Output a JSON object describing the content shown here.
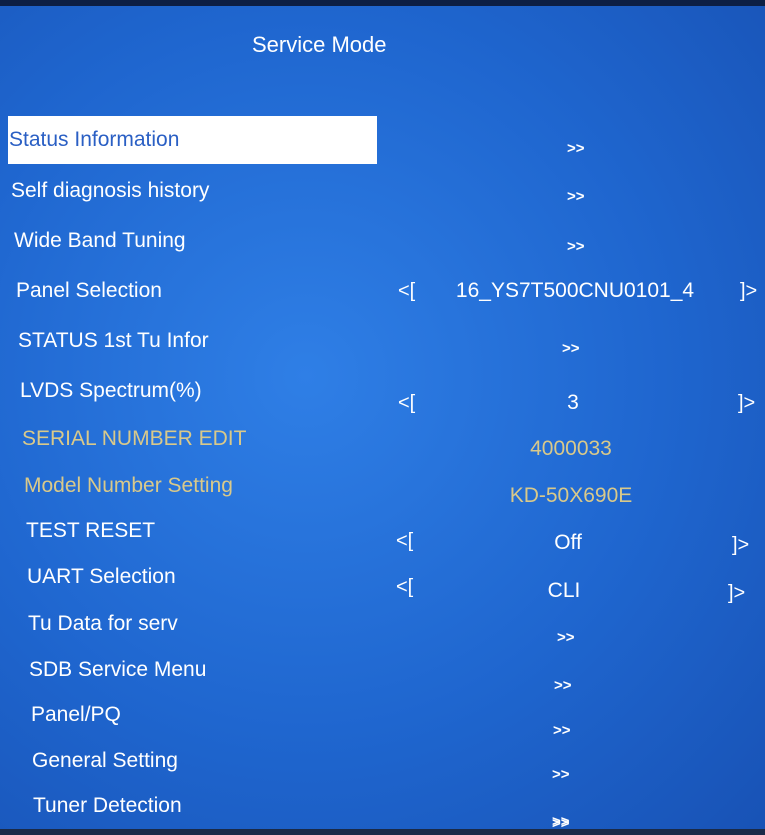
{
  "title": "Service Mode",
  "menu": [
    {
      "label": "Status Information",
      "kind": "submenu",
      "value": ">>"
    },
    {
      "label": "Self diagnosis history",
      "kind": "submenu",
      "value": ">>"
    },
    {
      "label": "Wide Band Tuning",
      "kind": "submenu",
      "value": ">>"
    },
    {
      "label": "Panel Selection",
      "kind": "selector",
      "value": "16_YS7T500CNU0101_4",
      "left": "<[",
      "right": "]>"
    },
    {
      "label": "STATUS 1st Tu Infor",
      "kind": "submenu",
      "value": ">>"
    },
    {
      "label": "LVDS Spectrum(%)",
      "kind": "selector",
      "value": "3",
      "left": "<[",
      "right": "]>"
    },
    {
      "label": "SERIAL NUMBER EDIT",
      "kind": "readonly",
      "value": "4000033"
    },
    {
      "label": "Model Number Setting",
      "kind": "readonly",
      "value": "KD-50X690E"
    },
    {
      "label": "TEST RESET",
      "kind": "selector",
      "value": "Off",
      "left": "<[",
      "right": "]>"
    },
    {
      "label": "UART Selection",
      "kind": "selector",
      "value": "CLI",
      "left": "<[",
      "right": "]>"
    },
    {
      "label": "Tu Data for serv",
      "kind": "submenu",
      "value": ">>"
    },
    {
      "label": "SDB Service Menu",
      "kind": "submenu",
      "value": ">>"
    },
    {
      "label": "Panel/PQ",
      "kind": "submenu",
      "value": ">>"
    },
    {
      "label": "General Setting",
      "kind": "submenu",
      "value": ">>"
    },
    {
      "label": "Tuner Detection",
      "kind": "submenu",
      "value": ">>"
    }
  ],
  "trailing_arrow": ">>",
  "colors": {
    "background": "#1f66cf",
    "selected_bg": "#ffffff",
    "selected_text": "#2a5fc4",
    "readonly_text": "#d9c98a",
    "text": "#ffffff"
  }
}
